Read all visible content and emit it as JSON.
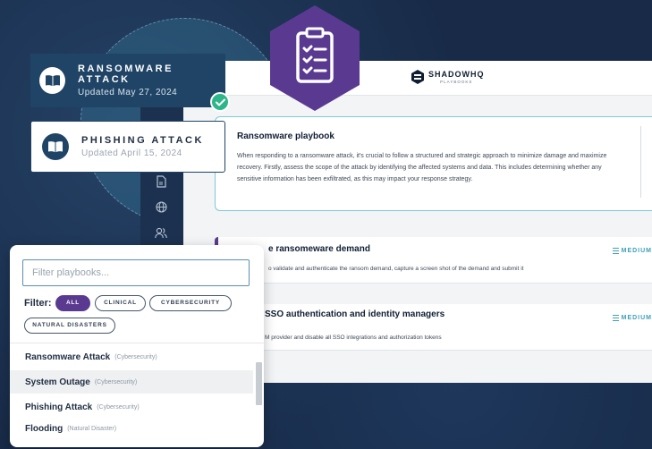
{
  "brand": {
    "name": "SHADOWHQ",
    "subtitle": "PLAYBOOKS"
  },
  "attack_cards": [
    {
      "name": "RANSOMWARE ATTACK",
      "date": "Updated May 27, 2024"
    },
    {
      "name": "PHISHING ATTACK",
      "date": "Updated April 15, 2024"
    }
  ],
  "playbook": {
    "title": "Ransomware playbook",
    "body": "When responding to a ransomware attack, it's crucial to follow a structured and strategic approach to minimize damage and maximize recovery. Firstly, assess the scope of the attack by identifying the affected systems and data. This includes determining whether any sensitive information has been exfiltrated, as this may impact your response strategy."
  },
  "steps": [
    {
      "title": "e ransomeware demand",
      "desc": "o validate and authenticate the ransom demand, capture a screen shot of the demand and submit it",
      "badge": "MEDIUM"
    },
    {
      "title": "SSO authentication and identity managers",
      "desc": "M provider and disable all SSO integrations and authorization tokens",
      "badge": "MEDIUM"
    }
  ],
  "filter": {
    "placeholder": "Filter playbooks...",
    "label": "Filter:",
    "chips": [
      {
        "label": "ALL",
        "active": true
      },
      {
        "label": "CLINICAL",
        "active": false
      },
      {
        "label": "CYBERSECURITY",
        "active": false
      },
      {
        "label": "NATURAL DISASTERS",
        "active": false
      }
    ],
    "items": [
      {
        "name": "Ransomware Attack",
        "category": "(Cybersecurity)"
      },
      {
        "name": "System Outage",
        "category": "(Cybersecurity)"
      },
      {
        "name": "Phishing Attack",
        "category": "(Cybersecurity)"
      },
      {
        "name": "Flooding",
        "category": "(Natural Disaster)"
      }
    ]
  },
  "icons": {
    "hex_logo": "clipboard-checklist-icon",
    "check": "checkmark-icon",
    "book": "open-book-icon",
    "sidebar": [
      "document-icon",
      "globe-icon",
      "users-icon"
    ]
  },
  "colors": {
    "accent_purple": "#5a3a91",
    "navy": "#1f4466",
    "teal": "#3fa0b8",
    "success_green": "#2eb58a"
  }
}
